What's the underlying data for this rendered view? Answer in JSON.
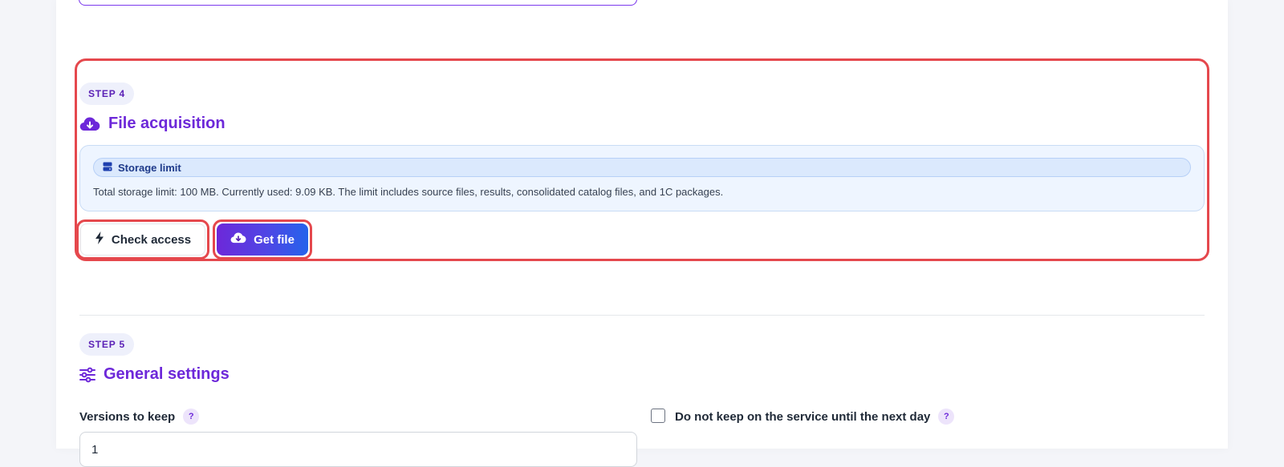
{
  "step4": {
    "badge": "STEP 4",
    "title": "File acquisition",
    "title_icon": "cloud-download-icon",
    "info": {
      "pill_label": "Storage limit",
      "pill_icon": "storage-icon",
      "text": "Total storage limit: 100 MB. Currently used: 9.09 KB. The limit includes source files, results, consolidated catalog files, and 1C packages."
    },
    "buttons": {
      "check_access": "Check access",
      "check_access_icon": "lightning-icon",
      "get_file": "Get file",
      "get_file_icon": "cloud-download-icon"
    }
  },
  "step5": {
    "badge": "STEP 5",
    "title": "General settings",
    "title_icon": "sliders-icon",
    "versions_label": "Versions to keep",
    "versions_value": "1",
    "help_mark": "?",
    "checkbox_label": "Do not keep on the service until the next day",
    "checkbox_checked": false
  },
  "colors": {
    "accent": "#6d28d9",
    "highlight": "#e5484d",
    "info_bg": "#eef5ff"
  }
}
